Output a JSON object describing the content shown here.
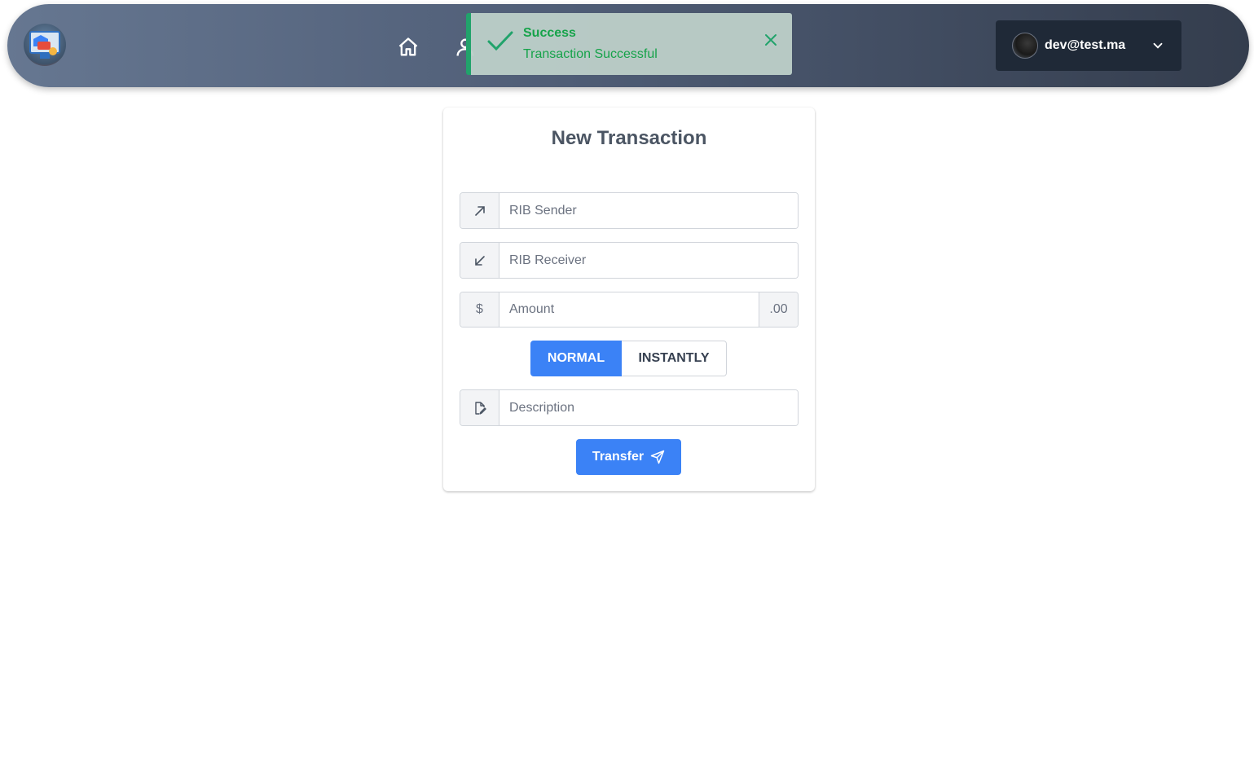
{
  "header": {
    "logo_icon": "bank-app-logo",
    "nav_icons": [
      "home-icon",
      "user-icon"
    ],
    "user_menu": {
      "email": "dev@test.ma",
      "dropdown_icon": "chevron-down-icon"
    }
  },
  "toast": {
    "title": "Success",
    "message": "Transaction Successful",
    "status_color": "#21a36b",
    "icon": "check-icon",
    "close_icon": "close-icon"
  },
  "form": {
    "title": "New Transaction",
    "rib_sender": {
      "placeholder": "RIB Sender",
      "value": "",
      "icon": "arrow-up-right-icon"
    },
    "rib_receiver": {
      "placeholder": "RIB Receiver",
      "value": "",
      "icon": "arrow-down-left-icon"
    },
    "amount": {
      "placeholder": "Amount",
      "value": "",
      "prefix": "$",
      "suffix": ".00"
    },
    "type_options": {
      "normal": "NORMAL",
      "instantly": "INSTANTLY",
      "selected": "NORMAL"
    },
    "description": {
      "placeholder": "Description",
      "value": "",
      "icon": "edit-file-icon"
    },
    "submit_label": "Transfer",
    "submit_icon": "send-icon",
    "accent_color": "#3b82f6"
  }
}
